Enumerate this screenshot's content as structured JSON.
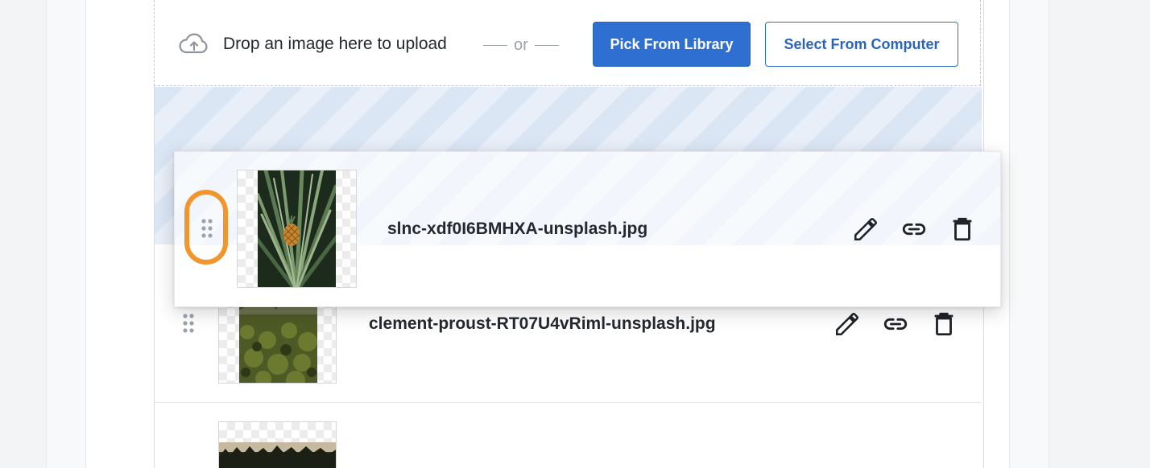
{
  "colors": {
    "accent": "#2f6fd1",
    "highlight": "#f0962d",
    "stripe_light": "#e8eff9",
    "stripe_dark": "#dbe6f5"
  },
  "dropzone": {
    "icon": "cloud-upload-icon",
    "text": "Drop an image here to upload",
    "separator": "or",
    "pick_button": "Pick From Library",
    "select_button": "Select From Computer"
  },
  "images": [
    {
      "filename": "slnc-xdf0I6BMHXA-unsplash.jpg",
      "state": "dragging",
      "handle_icon": "drag-handle-icon",
      "actions": [
        "edit-icon",
        "link-icon",
        "delete-icon"
      ]
    },
    {
      "filename": "clement-proust-RT07U4vRiml-unsplash.jpg",
      "state": "idle",
      "handle_icon": "drag-handle-icon",
      "actions": [
        "edit-icon",
        "link-icon",
        "delete-icon"
      ]
    },
    {
      "filename": "",
      "state": "idle"
    }
  ]
}
